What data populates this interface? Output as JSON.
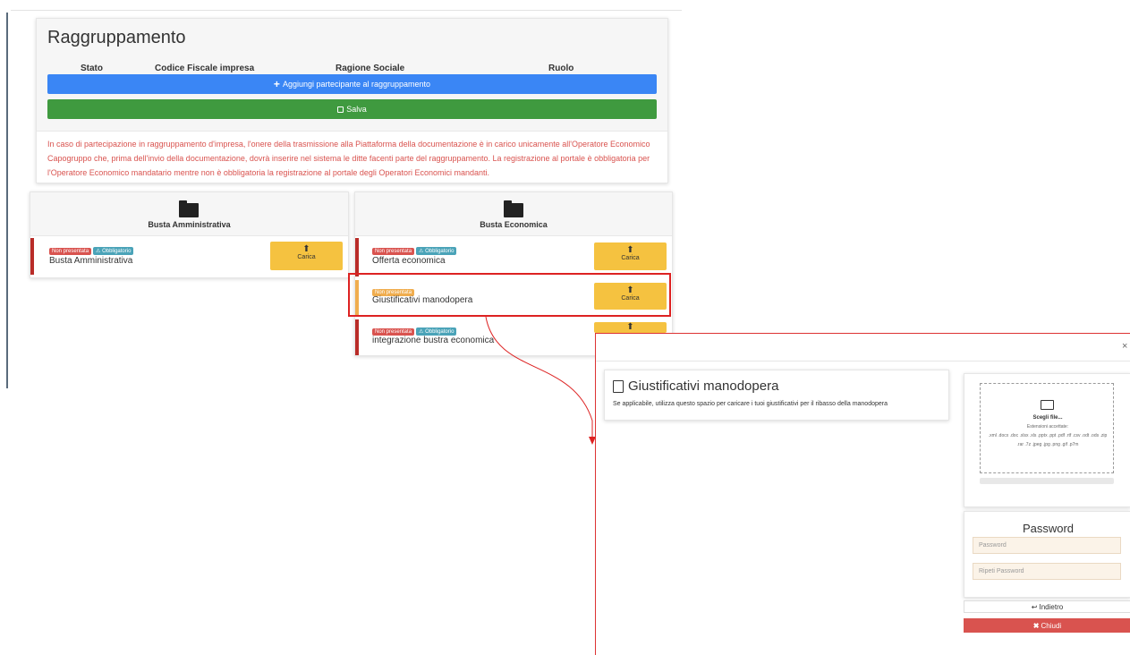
{
  "raggruppamento": {
    "title": "Raggruppamento",
    "columns": [
      "Stato",
      "Codice Fiscale impresa",
      "Ragione Sociale",
      "Ruolo"
    ],
    "add_button": "Aggiungi partecipante al raggruppamento",
    "save_button": "Salva",
    "notice": "In caso di partecipazione in raggruppamento d'impresa, l'onere della trasmissione alla Piattaforma della documentazione è in carico unicamente all'Operatore Economico Capogruppo che, prima dell'invio della documentazione, dovrà inserire nel sistema le ditte facenti parte del raggruppamento. La registrazione al portale è obbligatoria per l'Operatore Economico mandatario mentre non è obbligatoria la registrazione al portale degli Operatori Economici mandanti."
  },
  "busta_amministrativa": {
    "title": "Busta Amministrativa",
    "items": [
      {
        "badge1": "Non presentata",
        "badge2": "Obbligatorio",
        "name": "Busta Amministrativa",
        "button": "Carica"
      }
    ]
  },
  "busta_economica": {
    "title": "Busta Economica",
    "items": [
      {
        "badge1": "Non presentata",
        "badge2": "Obbligatorio",
        "name": "Offerta economica",
        "button": "Carica"
      },
      {
        "badge1": "Non presentata",
        "badge2": "",
        "name": "Giustificativi manodopera",
        "button": "Carica"
      },
      {
        "badge1": "Non presentata",
        "badge2": "Obbligatorio",
        "name": "integrazione bustra economica",
        "button": "Carica"
      }
    ]
  },
  "modal": {
    "close_x": "×",
    "title": "Giustificativi manodopera",
    "description": "Se applicabile, utilizza questo spazio per caricare i tuoi giustificativi per il ribasso della manodopera",
    "upload": {
      "choose": "Scegli file...",
      "accepted_label": "Estensioni accettate:",
      "extensions": ".xml .docx .doc .xlsx .xls .pptx .ppt .pdf .rtf .csv .odt .ods .zip .rar .7z .jpeg .jpg .png .gif .p7m"
    },
    "password": {
      "title": "Password",
      "password_placeholder": "Password",
      "repeat_placeholder": "Ripeti Password"
    },
    "back_button": "Indietro",
    "close_button": "Chiudi"
  },
  "colors": {
    "blue": "#3a86f5",
    "green": "#3f9a3f",
    "danger": "#d9534f",
    "warning": "#f5c240",
    "info": "#4aa3b8",
    "highlight": "#dd2222"
  }
}
